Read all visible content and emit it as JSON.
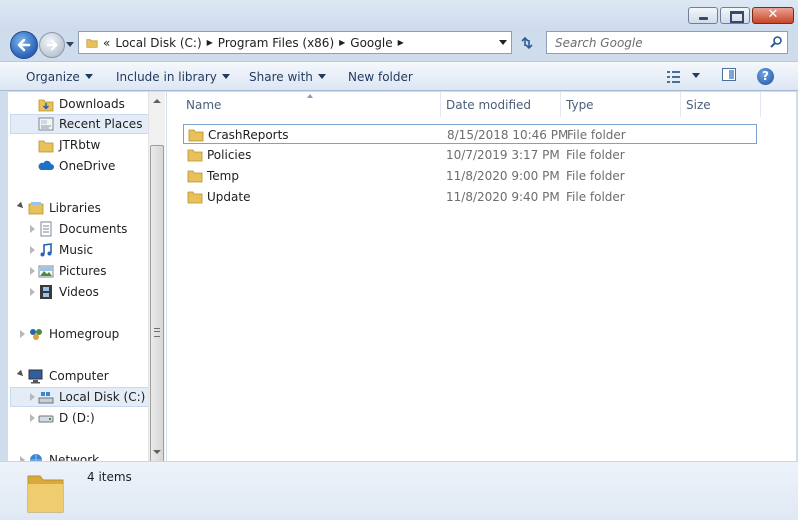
{
  "window": {
    "controls": {
      "minimize_icon": "minimize-icon",
      "maximize_icon": "maximize-icon",
      "close_icon": "close-icon"
    }
  },
  "address_bar": {
    "overflow": "«",
    "crumbs": [
      "Local Disk (C:)",
      "Program Files (x86)",
      "Google"
    ]
  },
  "search": {
    "placeholder": "Search Google"
  },
  "toolbar": {
    "organize": "Organize",
    "include_in_library": "Include in library",
    "share_with": "Share with",
    "new_folder": "New folder"
  },
  "nav_pane": {
    "favorites": [
      "Downloads",
      "Recent Places",
      "JTRbtw",
      "OneDrive"
    ],
    "libraries": {
      "label": "Libraries",
      "items": [
        "Documents",
        "Music",
        "Pictures",
        "Videos"
      ]
    },
    "homegroup": "Homegroup",
    "computer": {
      "label": "Computer",
      "items": [
        "Local Disk (C:)",
        "D (D:)"
      ]
    },
    "network": "Network"
  },
  "columns": [
    "Name",
    "Date modified",
    "Type",
    "Size"
  ],
  "files": [
    {
      "name": "CrashReports",
      "date": "8/15/2018 10:46 PM",
      "type": "File folder"
    },
    {
      "name": "Policies",
      "date": "10/7/2019 3:17 PM",
      "type": "File folder"
    },
    {
      "name": "Temp",
      "date": "11/8/2020 9:00 PM",
      "type": "File folder"
    },
    {
      "name": "Update",
      "date": "11/8/2020 9:40 PM",
      "type": "File folder"
    }
  ],
  "details": {
    "count": "4 items"
  },
  "colors": {
    "accent": "#2a62b6",
    "folder": "#e8c15a",
    "selection": "#e4ecf7"
  }
}
